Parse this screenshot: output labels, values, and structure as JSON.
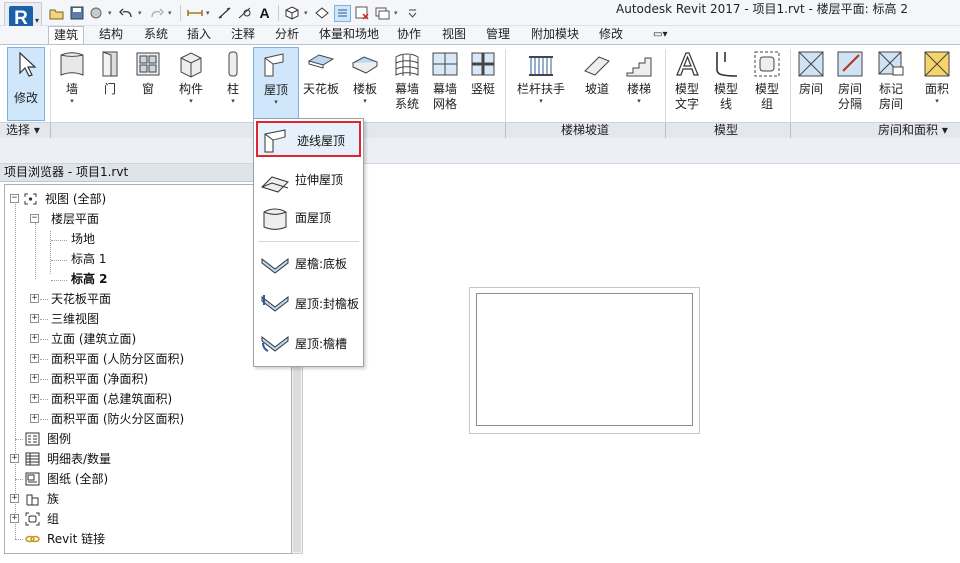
{
  "window": {
    "title": "Autodesk Revit 2017 -       项目1.rvt - 楼层平面: 标高 2",
    "app_letter": "R",
    "qat_text_icon": "A"
  },
  "tabs": [
    "建筑",
    "结构",
    "系统",
    "插入",
    "注释",
    "分析",
    "体量和场地",
    "协作",
    "视图",
    "管理",
    "附加模块",
    "修改"
  ],
  "tabs_extra": "▭▾",
  "ribbon": {
    "modify": "修改",
    "wall": "墙",
    "door": "门",
    "window": "窗",
    "component": "构件",
    "column": "柱",
    "roof": "屋顶",
    "ceiling": "天花板",
    "floor": "楼板",
    "curtain_system_1": "幕墙",
    "curtain_system_2": "系统",
    "curtain_grid_1": "幕墙",
    "curtain_grid_2": "网格",
    "mullion": "竖梃",
    "railing": "栏杆扶手",
    "ramp": "坡道",
    "stair": "楼梯",
    "model_text_1": "模型",
    "model_text_2": "文字",
    "model_line_1": "模型",
    "model_line_2": "线",
    "model_group_1": "模型",
    "model_group_2": "组",
    "room": "房间",
    "room_sep_1": "房间",
    "room_sep_2": "分隔",
    "tag_room_1": "标记",
    "tag_room_2": "房间",
    "area": "面积"
  },
  "panels": {
    "select": "选择 ▾",
    "circulation": "楼梯坡道",
    "model": "模型",
    "room_area": "房间和面积 ▾"
  },
  "project_browser": {
    "title": "项目浏览器 - 项目1.rvt",
    "nodes": [
      "视图 (全部)",
      "楼层平面",
      "场地",
      "标高 1",
      "标高 2",
      "天花板平面",
      "三维视图",
      "立面 (建筑立面)",
      "面积平面 (人防分区面积)",
      "面积平面 (净面积)",
      "面积平面 (总建筑面积)",
      "面积平面 (防火分区面积)",
      "图例",
      "明细表/数量",
      "图纸 (全部)",
      "族",
      "组",
      "Revit 链接"
    ]
  },
  "roof_menu": {
    "items": [
      "迹线屋顶",
      "拉伸屋顶",
      "面屋顶",
      "屋檐:底板",
      "屋顶:封檐板",
      "屋顶:檐槽"
    ],
    "highlighted": "迹线屋顶"
  },
  "colors": {
    "highlight_border": "#e0262d",
    "selected_button": "#cfe6fb",
    "revit_blue": "#1b60a8"
  }
}
